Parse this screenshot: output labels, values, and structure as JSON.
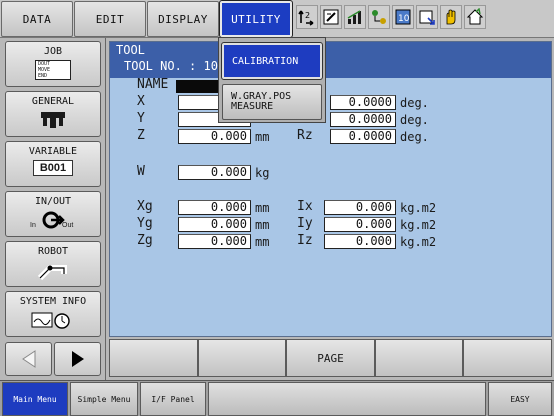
{
  "top_menu": {
    "data": "DATA",
    "edit": "EDIT",
    "display": "DISPLAY",
    "utility": "UTILITY"
  },
  "toolbar_icons": [
    "coordinate-icon",
    "edit-pad-icon",
    "signal-bars-icon",
    "network-icon",
    "tool-frame-icon",
    "select-icon",
    "hand-icon",
    "home-icon"
  ],
  "side_menu": {
    "job": "JOB",
    "job_icon_lines": [
      "DOUT",
      "MOVE",
      "END"
    ],
    "general": "GENERAL",
    "variable": "VARIABLE",
    "variable_value": "B001",
    "inout": "IN/OUT",
    "inout_in": "In",
    "inout_out": "Out",
    "robot": "ROBOT",
    "system_info": "SYSTEM INFO"
  },
  "content": {
    "title": "TOOL",
    "tool_no_label": "TOOL NO.",
    "tool_no_value": ": 10",
    "name_label": "NAME",
    "x_label": "X",
    "y_label": "Y",
    "z_label": "Z",
    "rz_label": "Rz",
    "z_value": "0.000",
    "z_unit": "mm",
    "rx_value": "0.0000",
    "ry_value": "0.0000",
    "rz_value": "0.0000",
    "deg_unit": "deg.",
    "w_label": "W",
    "w_value": "0.000",
    "w_unit": "kg",
    "xg_label": "Xg",
    "yg_label": "Yg",
    "zg_label": "Zg",
    "xg_value": "0.000",
    "yg_value": "0.000",
    "zg_value": "0.000",
    "mm_unit": "mm",
    "ix_label": "Ix",
    "iy_label": "Iy",
    "iz_label": "Iz",
    "ix_value": "0.000",
    "iy_value": "0.000",
    "iz_value": "0.000",
    "inertia_unit": "kg.m2"
  },
  "utility_dropdown": {
    "calibration": "CALIBRATION",
    "wgray_line1": "W.GRAY.POS",
    "wgray_line2": "MEASURE"
  },
  "bottom_buttons": {
    "page": "PAGE"
  },
  "status_bar": {
    "main_menu": "Main Menu",
    "simple_menu": "Simple Menu",
    "if_panel": "I/F Panel",
    "easy": "EASY"
  },
  "colors": {
    "accent_blue": "#1e3cc0",
    "content_bg": "#a9c6e6",
    "header_bg": "#3c5fa8"
  }
}
